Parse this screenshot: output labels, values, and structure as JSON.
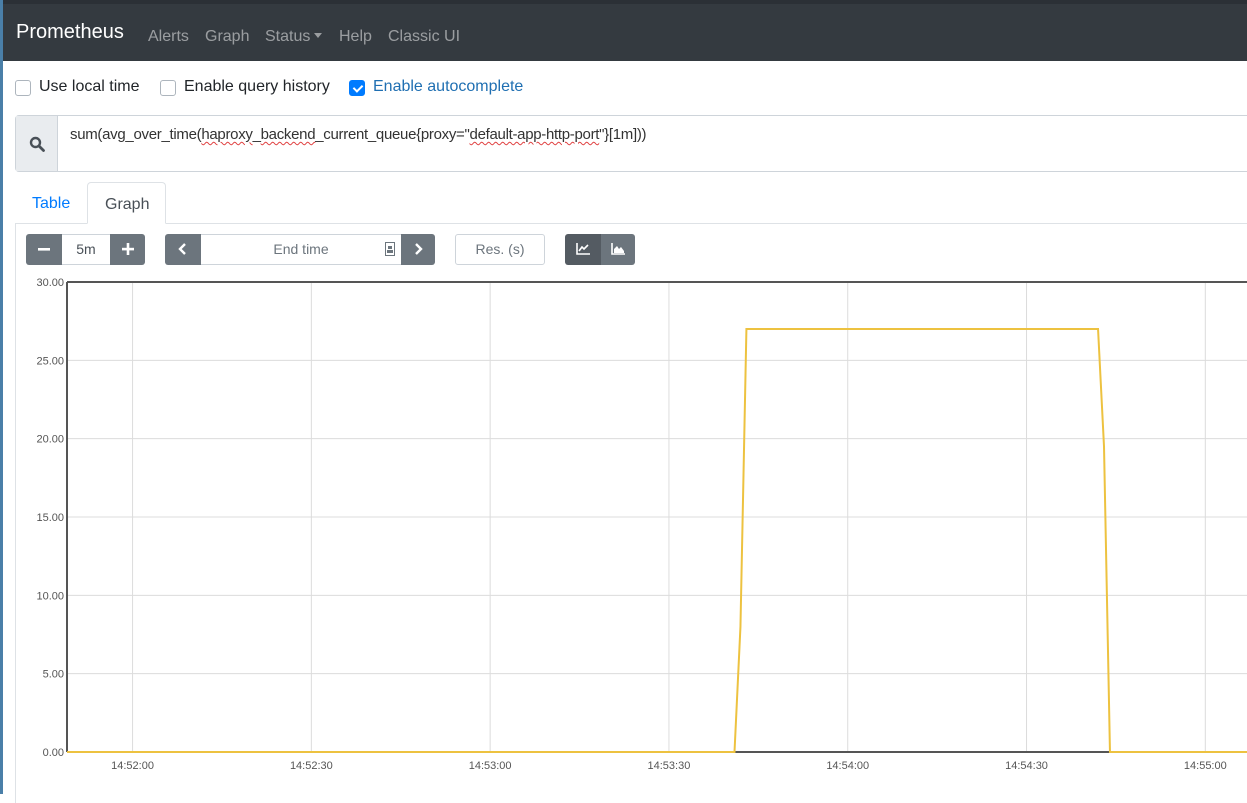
{
  "navbar": {
    "brand": "Prometheus",
    "links": [
      {
        "label": "Alerts"
      },
      {
        "label": "Graph"
      },
      {
        "label": "Status",
        "has_dropdown": true
      },
      {
        "label": "Help"
      },
      {
        "label": "Classic UI"
      }
    ]
  },
  "options": [
    {
      "label": "Use local time",
      "checked": false
    },
    {
      "label": "Enable query history",
      "checked": false
    },
    {
      "label": "Enable autocomplete",
      "checked": true
    }
  ],
  "query": {
    "icon": "search-icon",
    "parts": [
      "sum(avg_over_time(",
      "haproxy",
      "_",
      "backend",
      "_current_queue{proxy=\"",
      "default-app-http-port",
      "\"}[1m]))"
    ]
  },
  "tabs": [
    {
      "label": "Table",
      "active": false
    },
    {
      "label": "Graph",
      "active": true
    }
  ],
  "controls": {
    "range": "5m",
    "end_time_placeholder": "End time",
    "resolution_placeholder": "Res. (s)",
    "minus_icon": "minus-icon",
    "plus_icon": "plus-icon",
    "prev_icon": "chevron-left-icon",
    "next_icon": "chevron-right-icon",
    "calendar_icon": "calendar-icon",
    "line_mode_icon": "line-chart-icon",
    "stacked_mode_icon": "area-chart-icon",
    "mode_selected": "line"
  },
  "chart_data": {
    "type": "line",
    "title": "",
    "xlabel": "",
    "ylabel": "",
    "ylim": [
      0,
      30
    ],
    "yticks": [
      "0.00",
      "5.00",
      "10.00",
      "15.00",
      "20.00",
      "25.00",
      "30.00"
    ],
    "xlim_seconds": [
      "14:51:49",
      "14:55:08"
    ],
    "xticks": [
      "14:52:00",
      "14:52:30",
      "14:53:00",
      "14:53:30",
      "14:54:00",
      "14:54:30",
      "14:55:00"
    ],
    "grid": true,
    "series": [
      {
        "name": "sum(avg_over_time(haproxy_backend_current_queue{proxy=\"default-app-http-port\"}[1m]))",
        "color": "#edc240",
        "points": [
          [
            "14:51:49",
            0
          ],
          [
            "14:53:41",
            0
          ],
          [
            "14:53:42",
            8
          ],
          [
            "14:53:43",
            27
          ],
          [
            "14:54:42",
            27
          ],
          [
            "14:54:43",
            19.5
          ],
          [
            "14:54:44",
            0
          ],
          [
            "14:55:08",
            0
          ]
        ]
      }
    ]
  }
}
